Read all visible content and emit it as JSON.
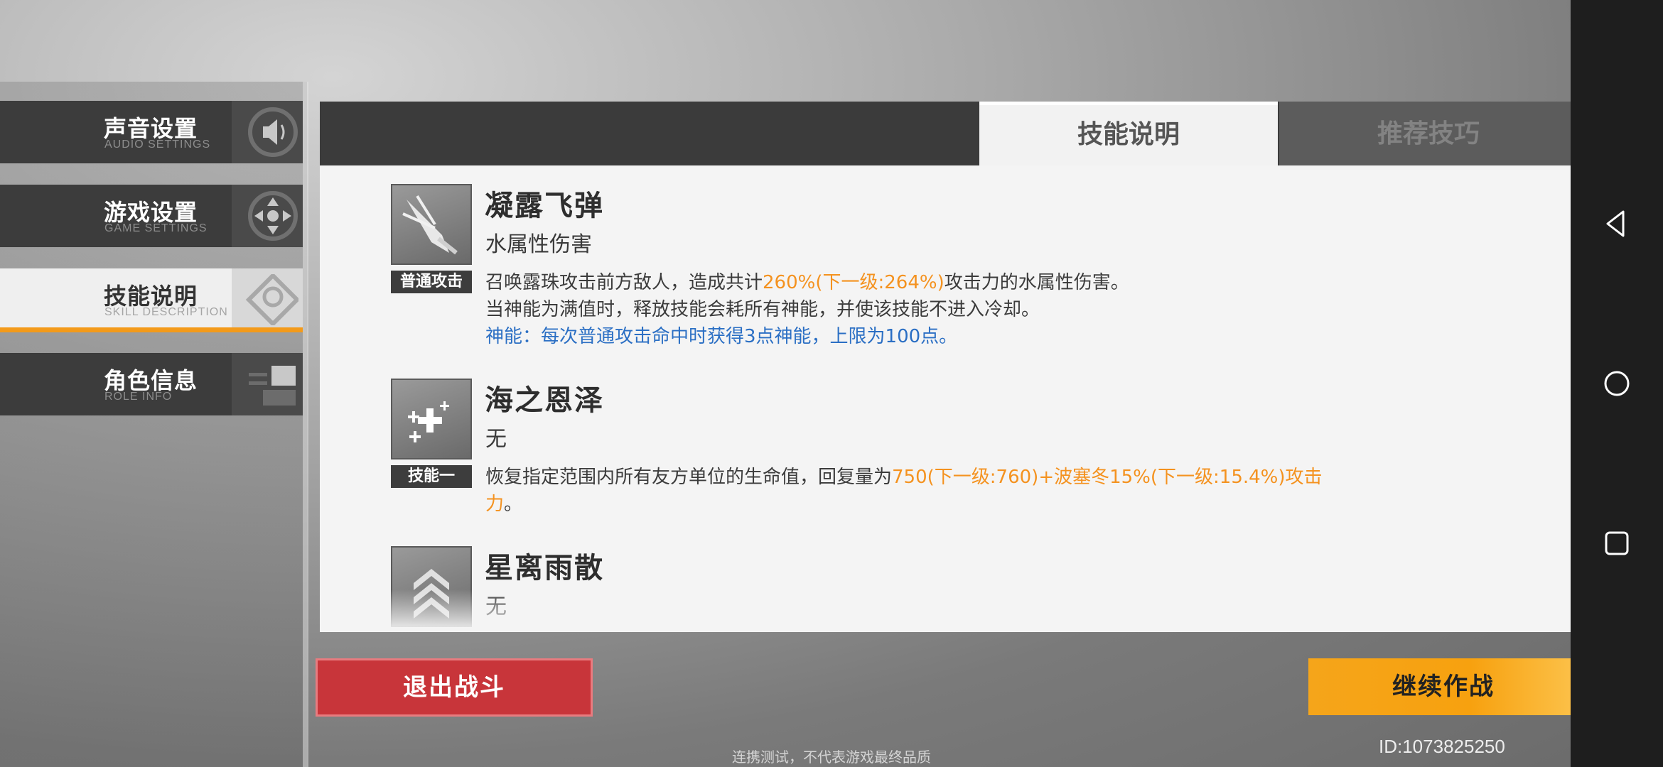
{
  "menu": {
    "items": [
      {
        "cn": "声音设置",
        "en": "AUDIO SETTINGS",
        "icon": "speaker-icon"
      },
      {
        "cn": "游戏设置",
        "en": "GAME SETTINGS",
        "icon": "gamepad-icon"
      },
      {
        "cn": "技能说明",
        "en": "SKILL DESCRIPTION",
        "icon": "target-icon",
        "active": true
      },
      {
        "cn": "角色信息",
        "en": "ROLE INFO",
        "icon": "id-card-icon"
      }
    ]
  },
  "tabs": {
    "active": "技能说明",
    "inactive": "推荐技巧"
  },
  "skills": [
    {
      "name": "凝露飞弹",
      "type": "水属性伤害",
      "tag": "普通攻击",
      "desc_line1_pre": "召唤露珠攻击前方敌人，造成共计",
      "desc_line1_hl": "260%(下一级:264%)",
      "desc_line1_post": "攻击力的水属性伤害。",
      "desc_line2": "当神能为满值时，释放技能会耗所有神能，并使该技能不进入冷却。",
      "desc_line3": "神能：每次普通攻击命中时获得3点神能，上限为100点。"
    },
    {
      "name": "海之恩泽",
      "type": "无",
      "tag": "技能一",
      "desc_pre": "恢复指定范围内所有友方单位的生命值，回复量为",
      "desc_hl": "750(下一级:760)+波塞冬15%(下一级:15.4%)攻击力",
      "desc_post": "。"
    },
    {
      "name": "星离雨散",
      "type": "无"
    }
  ],
  "buttons": {
    "exit": "退出战斗",
    "continue": "继续作战"
  },
  "footer": {
    "disclaimer": "连携测试，不代表游戏最终品质",
    "uid": "ID:1073825250"
  },
  "colors": {
    "accent_orange": "#f39a1a",
    "highlight_orange": "#f4921f",
    "info_blue": "#2b6fc4",
    "exit_red": "#c8353a"
  }
}
